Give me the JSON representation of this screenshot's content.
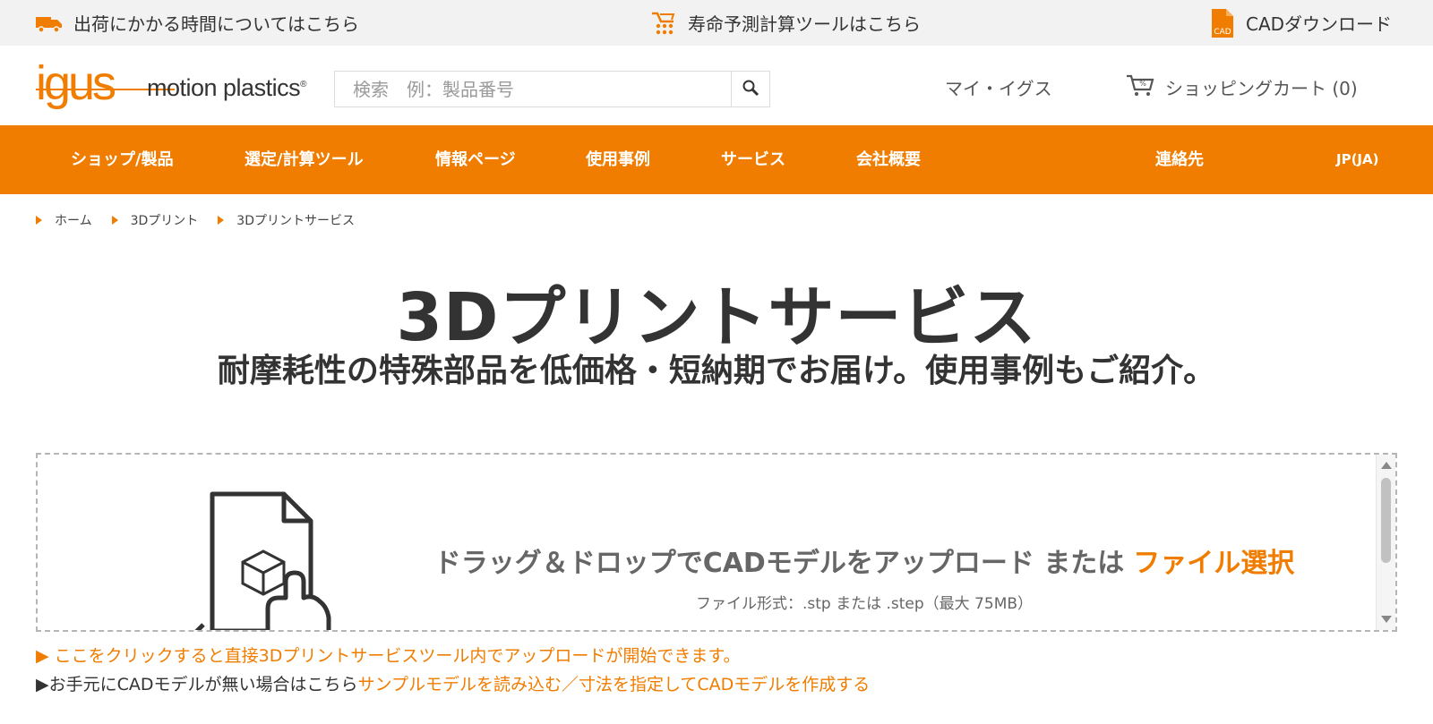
{
  "colors": {
    "accent": "#f07d00",
    "text": "#333333",
    "topbar_bg": "#f2f2f2"
  },
  "topbar": {
    "shipping": {
      "label": "出荷にかかる時間についてはこちら",
      "icon": "truck-icon"
    },
    "lifetime": {
      "label": "寿命予測計算ツールはこちら",
      "icon": "calculator-icon"
    },
    "cad": {
      "label": "CADダウンロード",
      "icon": "cad-file-icon",
      "icon_text": "CAD"
    }
  },
  "header": {
    "logo": {
      "brand": "igus",
      "tagline": "motion plastics",
      "reg": "®"
    },
    "search": {
      "placeholder": "検索　例：製品番号",
      "value": "",
      "icon": "search-icon"
    },
    "my_igus": "マイ・イグス",
    "cart": {
      "label": "ショッピングカート (0)",
      "icon": "cart-icon"
    }
  },
  "nav": {
    "items": [
      {
        "label": "ショップ/製品"
      },
      {
        "label": "選定/計算ツール"
      },
      {
        "label": "情報ページ"
      },
      {
        "label": "使用事例"
      },
      {
        "label": "サービス"
      },
      {
        "label": "会社概要"
      },
      {
        "label": "連絡先"
      },
      {
        "label": "JP(JA)"
      }
    ]
  },
  "breadcrumb": [
    {
      "label": "ホーム"
    },
    {
      "label": "3Dプリント"
    },
    {
      "label": "3Dプリントサービス"
    }
  ],
  "main": {
    "title": "3Dプリントサービス",
    "subtitle": "耐摩耗性の特殊部品を低価格・短納期でお届け。使用事例もご紹介。"
  },
  "upload": {
    "text": "ドラッグ＆ドロップでCADモデルをアップロード または",
    "select_label": "ファイル選択",
    "formats": "ファイル形式：.stp または .step（最大 75MB）",
    "illustration_icon": "file-upload-hand-icon"
  },
  "notes": {
    "direct_upload": "▶ ここをクリックすると直接3Dプリントサービスツール内でアップロードが開始できます。",
    "no_cad_prefix": "▶お手元にCADモデルが無い場合はこちら",
    "sample_link": "サンプルモデルを読み込む",
    "separator": "／",
    "create_link": "寸法を指定してCADモデルを作成する"
  }
}
